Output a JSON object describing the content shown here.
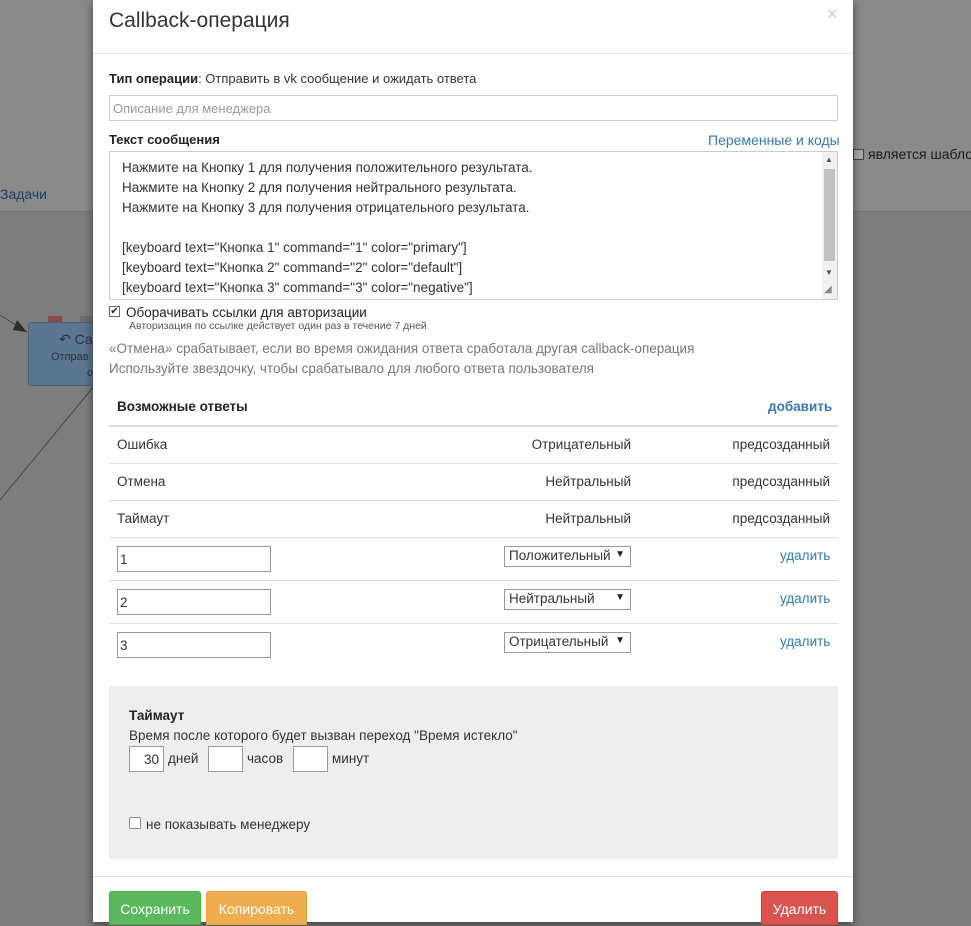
{
  "background": {
    "tasks_link": "Задачи",
    "template_label": "является шабло",
    "node_title": "Са",
    "node_line1": "Отправ",
    "node_line2": "о"
  },
  "modal": {
    "title": "Callback-операция",
    "close_icon": "×",
    "operation_type_label": "Тип операции",
    "operation_type_value": ": Отправить в vk сообщение и ожидать ответа",
    "description_placeholder": "Описание для менеджера",
    "message_label": "Текст сообщения",
    "variables_link": "Переменные и коды",
    "message_text": "Нажмите на Кнопку 1 для получения положительного результата.\nНажмите на Кнопку 2 для получения нейтрального результата.\nНажмите на Кнопку 3 для получения отрицательного результата.\n\n[keyboard text=\"Кнопка 1\" command=\"1\" color=\"primary\"]\n[keyboard text=\"Кнопка 2\" command=\"2\" color=\"default\"]\n[keyboard text=\"Кнопка 3\" command=\"3\" color=\"negative\"]",
    "wrap_links_checked": true,
    "wrap_links_label": "Оборачивать ссылки для авторизации",
    "wrap_links_hint": "Авторизация по ссылке действует один раз в течение 7 дней",
    "note_cancel": "«Отмена» срабатывает, если во время ожидания ответа сработала другая callback-операция",
    "note_star": "Используйте звездочку, чтобы срабатывало для любого ответа пользователя"
  },
  "answers": {
    "title": "Возможные ответы",
    "add_link": "добавить",
    "predefined": [
      {
        "name": "Ошибка",
        "type": "Отрицательный",
        "status": "предсозданный"
      },
      {
        "name": "Отмена",
        "type": "Нейтральный",
        "status": "предсозданный"
      },
      {
        "name": "Таймаут",
        "type": "Нейтральный",
        "status": "предсозданный"
      }
    ],
    "custom": [
      {
        "value": "1",
        "type": "Положительный",
        "delete": "удалить"
      },
      {
        "value": "2",
        "type": "Нейтральный",
        "delete": "удалить"
      },
      {
        "value": "3",
        "type": "Отрицательный",
        "delete": "удалить"
      }
    ]
  },
  "timeout": {
    "title": "Таймаут",
    "description": "Время после которого будет вызван переход \"Время истекло\"",
    "days_value": "30",
    "days_label": "дней",
    "hours_value": "",
    "hours_label": "часов",
    "minutes_value": "",
    "minutes_label": "минут",
    "hide_label": "не показывать менеджеру"
  },
  "footer": {
    "save": "Сохранить",
    "copy": "Копировать",
    "delete": "Удалить"
  },
  "colors": {
    "primary_link": "#337ab7",
    "save": "#5cb85c",
    "copy": "#f0ad4e",
    "delete": "#d9534f"
  }
}
